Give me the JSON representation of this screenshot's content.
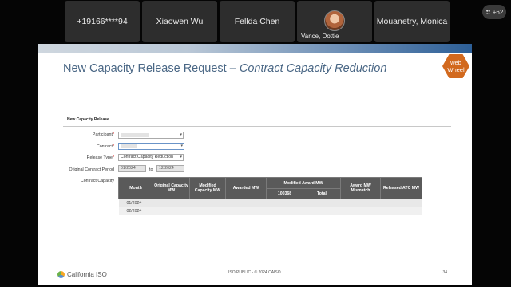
{
  "participants": [
    {
      "name": "+19166****94"
    },
    {
      "name": "Xiaowen Wu"
    },
    {
      "name": "Fellda Chen"
    },
    {
      "name": "Vance, Dottie",
      "has_video": true
    },
    {
      "name": "Mouanetry, Monica"
    }
  ],
  "overflow_badge": "+62",
  "slide": {
    "title_main": "New Capacity Release Request – ",
    "title_italic": "Contract Capacity Reduction",
    "web_badge_line1": "web",
    "web_badge_line2": "Wheel",
    "form_header": "New Capacity Release",
    "fields": {
      "participant_label": "Participant",
      "contract_label": "Contract",
      "release_type_label": "Release Type",
      "release_type_value": "Contract Capacity Reduction",
      "period_label": "Original Contract Period",
      "period_start": "01/2024",
      "period_to": "to",
      "period_end": "12/2024",
      "capacity_label": "Contract Capacity"
    },
    "table": {
      "headers": {
        "month": "Month",
        "original": "Original Capacity MW",
        "modified": "Modified Capacity MW",
        "awarded": "Awarded MW",
        "modified_award": "Modified Award MW",
        "sub_id": "100368",
        "sub_total": "Total",
        "mismatch": "Award MW Mismatch",
        "released": "Released ATC MW"
      },
      "rows": [
        {
          "month": "01/2024"
        },
        {
          "month": "02/2024"
        }
      ]
    },
    "footer": {
      "logo_text": "California ISO",
      "center": "ISO PUBLIC - © 2024 CAISO",
      "page": "34"
    }
  },
  "colors": {
    "title": "#4a6785",
    "badge": "#d2691e",
    "table_header": "#5a5a5a"
  }
}
